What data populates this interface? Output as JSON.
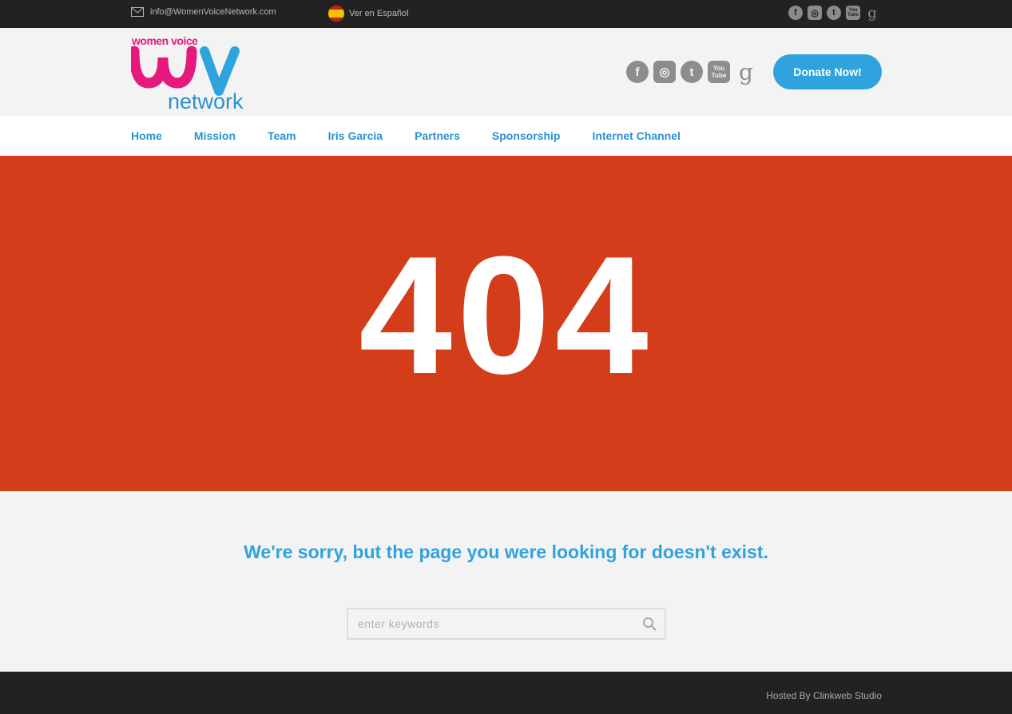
{
  "topbar": {
    "email": "info@WomenVoiceNetwork.com",
    "language_link": "Ver en Español",
    "social_icons": [
      "facebook-icon",
      "instagram-icon",
      "twitter-icon",
      "youtube-icon",
      "google-icon"
    ]
  },
  "header": {
    "logo": {
      "line1": "women voice",
      "letters": "WV",
      "line2": "network"
    },
    "social": {
      "facebook": "f",
      "instagram": "◎",
      "twitter": "t",
      "youtube": "You Tube",
      "google": "g"
    },
    "donate_label": "Donate Now!"
  },
  "nav": {
    "items": [
      {
        "label": "Home"
      },
      {
        "label": "Mission"
      },
      {
        "label": "Team"
      },
      {
        "label": "Iris Garcia"
      },
      {
        "label": "Partners"
      },
      {
        "label": "Sponsorship"
      },
      {
        "label": "Internet Channel"
      }
    ]
  },
  "hero": {
    "code": "404"
  },
  "content": {
    "message": "We're sorry, but the page you were looking for doesn't exist.",
    "search_placeholder": "enter keywords"
  },
  "footer": {
    "hosted": "Hosted By Clinkweb Studio"
  },
  "colors": {
    "accent": "#2ea3de",
    "hero": "#d43d1a",
    "dark": "#222222",
    "logo_pink": "#e5197e"
  }
}
